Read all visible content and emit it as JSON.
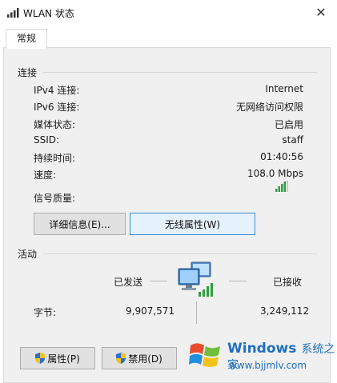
{
  "window": {
    "title": "WLAN 状态"
  },
  "tabs": [
    {
      "label": "常规"
    }
  ],
  "connection": {
    "heading": "连接",
    "rows": [
      {
        "label": "IPv4 连接:",
        "value": "Internet"
      },
      {
        "label": "IPv6 连接:",
        "value": "无网络访问权限"
      },
      {
        "label": "媒体状态:",
        "value": "已启用"
      },
      {
        "label": "SSID:",
        "value": "staff"
      },
      {
        "label": "持续时间:",
        "value": "01:40:56"
      },
      {
        "label": "速度:",
        "value": "108.0 Mbps"
      }
    ],
    "signal_label": "信号质量:",
    "signal_bars": 4
  },
  "buttons": {
    "details": "详细信息(E)...",
    "wireless_props": "无线属性(W)",
    "properties": "属性(P)",
    "disable": "禁用(D)"
  },
  "activity": {
    "heading": "活动",
    "sent_label": "已发送",
    "received_label": "已接收",
    "bytes_label": "字节:",
    "bytes_sent": "9,907,571",
    "bytes_received": "3,249,112"
  },
  "watermark": {
    "brand": "Windows",
    "brand_sub": "系统之家",
    "url": "www.bjjmlv.com"
  },
  "colors": {
    "signal": "#2e9e3e",
    "accent": "#3c8fd8",
    "watermark": "#1f6fc0"
  }
}
